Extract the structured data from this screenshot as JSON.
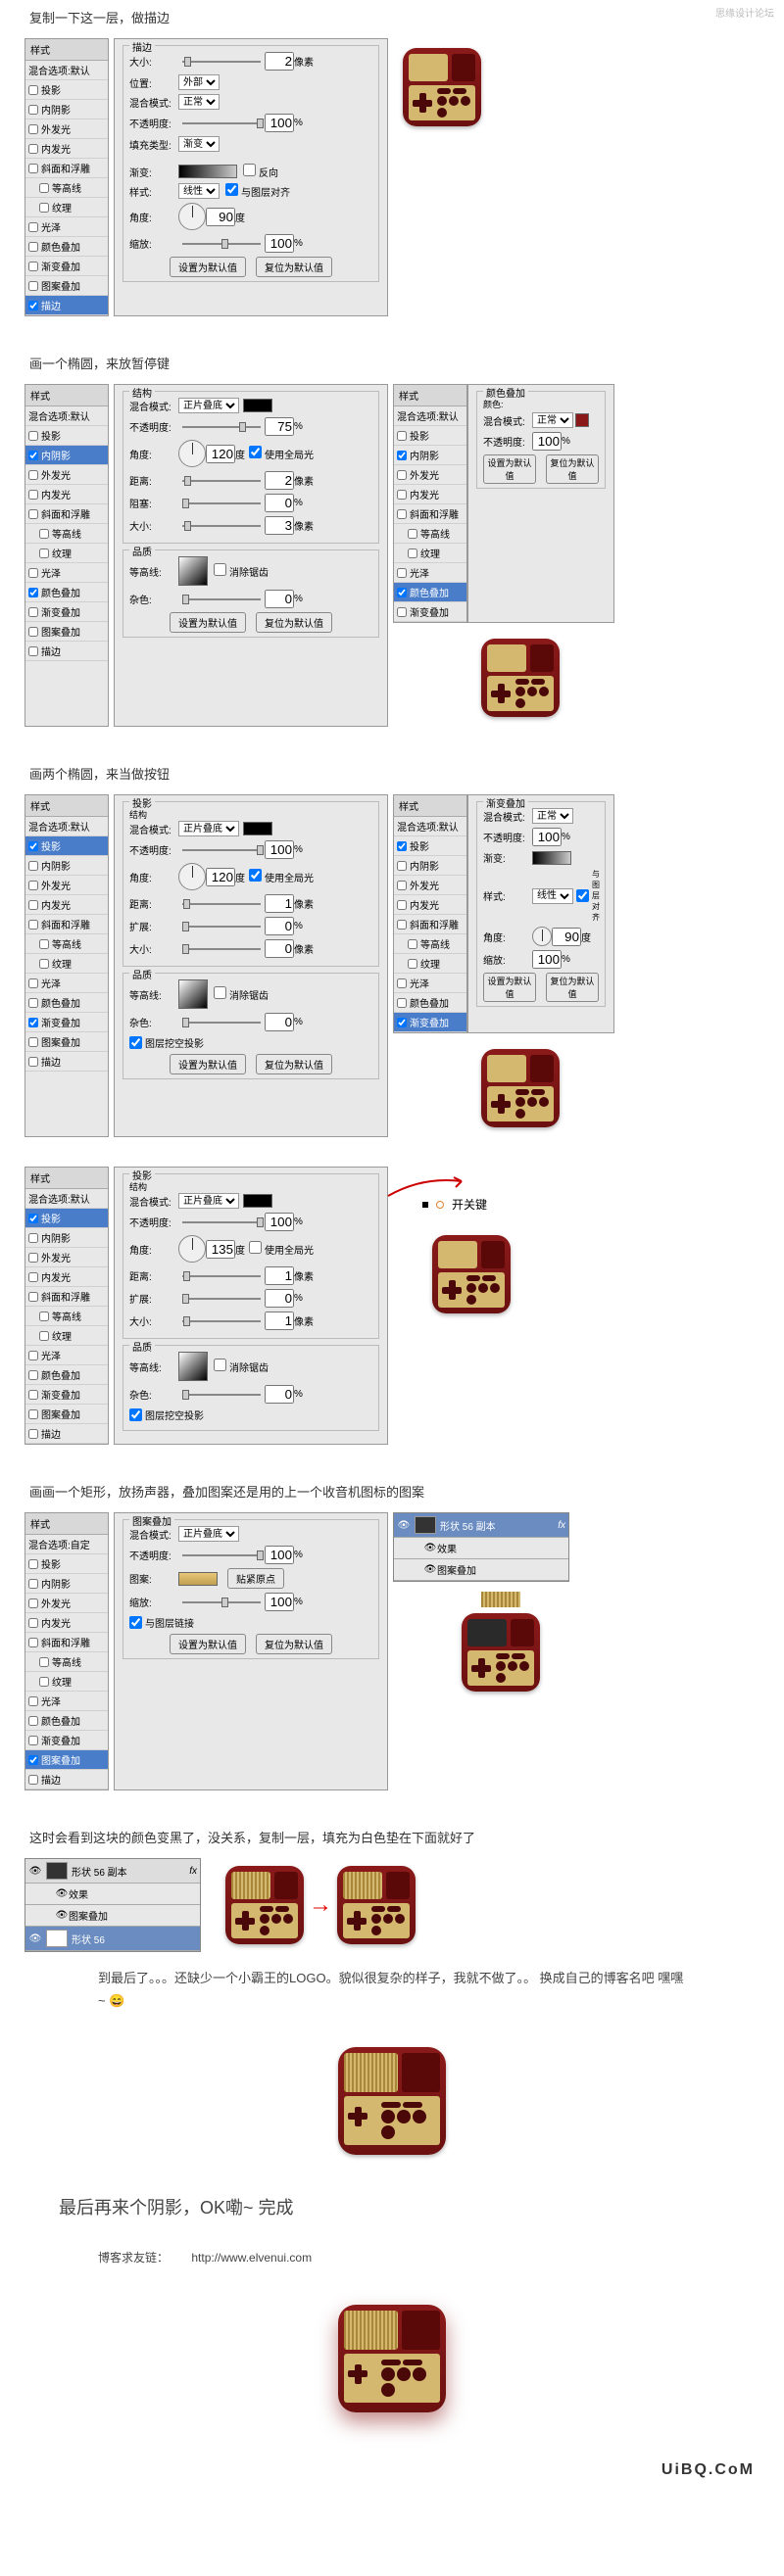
{
  "watermark": "思缘设计论坛",
  "footer_watermark": "UiBQ.CoM",
  "sections": {
    "s1": {
      "title": "复制一下这一层，做描边"
    },
    "s2": {
      "title": "画一个椭圆，来放暂停键"
    },
    "s3": {
      "title": "画两个椭圆，来当做按钮"
    },
    "s5": {
      "title": "画画一个矩形，放扬声器，叠加图案还是用的上一个收音机图标的图案"
    },
    "s6": {
      "title": "这时会看到这块的颜色变黑了，没关系，复制一层，填充为白色垫在下面就好了"
    }
  },
  "styles": {
    "header": "样式",
    "opts": "混合选项:默认",
    "opts_custom": "混合选项:自定",
    "items": [
      "投影",
      "内阴影",
      "外发光",
      "内发光",
      "斜面和浮雕",
      "等高线",
      "纹理",
      "光泽",
      "颜色叠加",
      "渐变叠加",
      "图案叠加",
      "描边"
    ]
  },
  "labels": {
    "struct": "结构",
    "quality": "品质",
    "blend_mode": "混合模式:",
    "opacity": "不透明度:",
    "angle": "角度:",
    "distance": "距离:",
    "spread": "扩展:",
    "choke": "阻塞:",
    "size": "大小:",
    "noise": "杂色:",
    "contour": "等高线:",
    "position": "位置:",
    "fill_type": "填充类型:",
    "color": "颜色:",
    "gradient": "渐变:",
    "style": "样式:",
    "scale": "缩放:",
    "pattern": "图案:",
    "use_global": "使用全局光",
    "anti_alias": "消除锯齿",
    "knockout": "图层挖空投影",
    "reverse": "反向",
    "align_layer": "与图层对齐",
    "link_layer": "与图层链接",
    "snap": "贴紧原点",
    "px": "像素",
    "pct": "%",
    "deg": "度",
    "set_default": "设置为默认值",
    "reset_default": "复位为默认值",
    "multiply": "正片叠底",
    "normal": "正常",
    "linear": "线性",
    "outer": "外部",
    "color_overlay_header": "颜色叠加",
    "grad_overlay_header": "渐变叠加",
    "pattern_overlay_header": "图案叠加",
    "stroke_header": "描边",
    "shadow_header": "投影",
    "inner_shadow_header": "内阴影"
  },
  "values": {
    "stroke_size": "2",
    "opacity_100": "100",
    "opacity_75": "75",
    "angle_90": "90",
    "angle_120": "120",
    "angle_135": "135",
    "dist_2": "2",
    "dist_1": "1",
    "size_0": "0",
    "size_3": "3",
    "noise_0": "0",
    "scale_100": "100"
  },
  "annotations": {
    "switch": "开关键"
  },
  "layers": {
    "shape56copy": "形状 56 副本",
    "shape56": "形状 56",
    "effects": "效果",
    "pattern_overlay": "图案叠加",
    "fx": "fx"
  },
  "body_text": {
    "logo": "到最后了。。。还缺少一个小霸王的LOGO。貌似很复杂的样子，我就不做了。。 换成自己的博客名吧  嘿嘿~  😄",
    "final": "最后再来个阴影，OK嘞~   完成",
    "link_label": "博客求友链：",
    "link": "http://www.elvenui.com"
  }
}
